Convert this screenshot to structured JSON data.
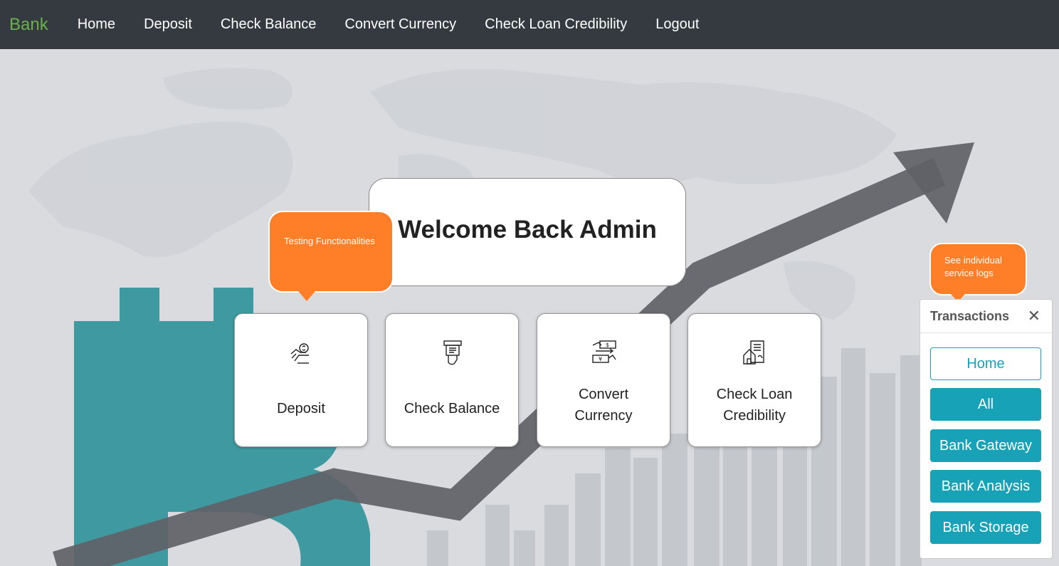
{
  "navbar": {
    "brand": "Bank",
    "links": [
      "Home",
      "Deposit",
      "Check Balance",
      "Convert Currency",
      "Check Loan Credibility",
      "Logout"
    ]
  },
  "welcome": {
    "title": "Welcome Back Admin"
  },
  "tooltips": {
    "testing": "Testing Functionalities",
    "logs_line1": "See individual",
    "logs_line2": "service logs"
  },
  "services": [
    {
      "label": "Deposit",
      "icon": "deposit-hand-coin-icon"
    },
    {
      "label": "Check Balance",
      "icon": "atm-balance-icon"
    },
    {
      "label_line1": "Convert",
      "label_line2": "Currency",
      "icon": "currency-exchange-icon"
    },
    {
      "label_line1": "Check Loan",
      "label_line2": "Credibility",
      "icon": "loan-document-house-icon"
    }
  ],
  "transactions": {
    "title": "Transactions",
    "close": "✕",
    "buttons": [
      "Home",
      "All",
      "Bank Gateway",
      "Bank Analysis",
      "Bank Storage"
    ]
  },
  "colors": {
    "navbar": "#343a40",
    "brand": "#6ab04c",
    "accent": "#17a2b8",
    "tooltip": "#fe7f28",
    "bitcoin": "#3e9aa0"
  }
}
